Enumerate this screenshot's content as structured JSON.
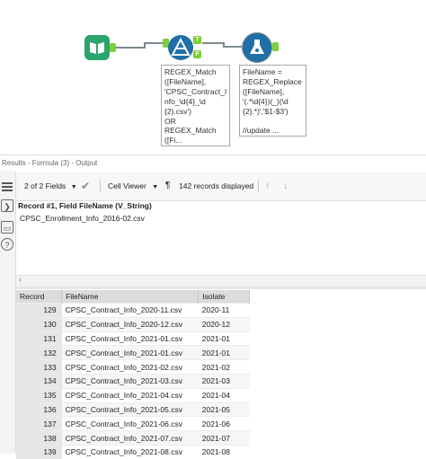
{
  "workflow": {
    "filter_annotation": [
      "REGEX_Match",
      "([FileName],",
      "'CPSC_Contract_I",
      "nfo_\\d{4}_\\d",
      "{2}.csv')",
      "OR",
      "REGEX_Match",
      "([Fi..."
    ],
    "formula_annotation": [
      "FileName =",
      "REGEX_Replace",
      "([FileName],",
      "'(.*\\d{4})(_)(\\d",
      "{2}.*)','$1-$3')",
      "",
      "//update ..."
    ],
    "filter_true_anchor": "T",
    "filter_false_anchor": "F"
  },
  "results": {
    "title": "Results - Formula (3) - Output",
    "fields_selector": "2 of 2 Fields",
    "cell_viewer": "Cell Viewer",
    "records_displayed": "142 records displayed",
    "record_field_label": "Record #1, Field FileName (V_String)",
    "cell_value": "CPSC_Enrollment_Info_2016-02.csv",
    "columns": [
      "Record",
      "FileName",
      "Isolate"
    ],
    "rows": [
      {
        "record": "129",
        "filename": "CPSC_Contract_Info_2020-11.csv",
        "isolate": "2020-11"
      },
      {
        "record": "130",
        "filename": "CPSC_Contract_Info_2020-12.csv",
        "isolate": "2020-12"
      },
      {
        "record": "131",
        "filename": "CPSC_Contract_Info_2021-01.csv",
        "isolate": "2021-01"
      },
      {
        "record": "132",
        "filename": "CPSC_Contract_Info_2021-01.csv",
        "isolate": "2021-01"
      },
      {
        "record": "133",
        "filename": "CPSC_Contract_Info_2021-02.csv",
        "isolate": "2021-02"
      },
      {
        "record": "134",
        "filename": "CPSC_Contract_Info_2021-03.csv",
        "isolate": "2021-03"
      },
      {
        "record": "135",
        "filename": "CPSC_Contract_Info_2021-04.csv",
        "isolate": "2021-04"
      },
      {
        "record": "136",
        "filename": "CPSC_Contract_Info_2021-05.csv",
        "isolate": "2021-05"
      },
      {
        "record": "137",
        "filename": "CPSC_Contract_Info_2021-06.csv",
        "isolate": "2021-06"
      },
      {
        "record": "138",
        "filename": "CPSC_Contract_Info_2021-07.csv",
        "isolate": "2021-07"
      },
      {
        "record": "139",
        "filename": "CPSC_Contract_Info_2021-08.csv",
        "isolate": "2021-08"
      }
    ]
  },
  "icons": [
    "input-data-icon",
    "filter-icon",
    "formula-icon",
    "checkmark-icon",
    "pilcrow-icon",
    "arrow-up-icon",
    "arrow-down-icon",
    "chevron-down-icon"
  ],
  "colors": {
    "input_tool": "#2aa56b",
    "filter_tool": "#1f6fa8",
    "formula_tool": "#1f6fa8",
    "anchor": "#7ccf37",
    "header_bg": "#dcdcdc"
  }
}
